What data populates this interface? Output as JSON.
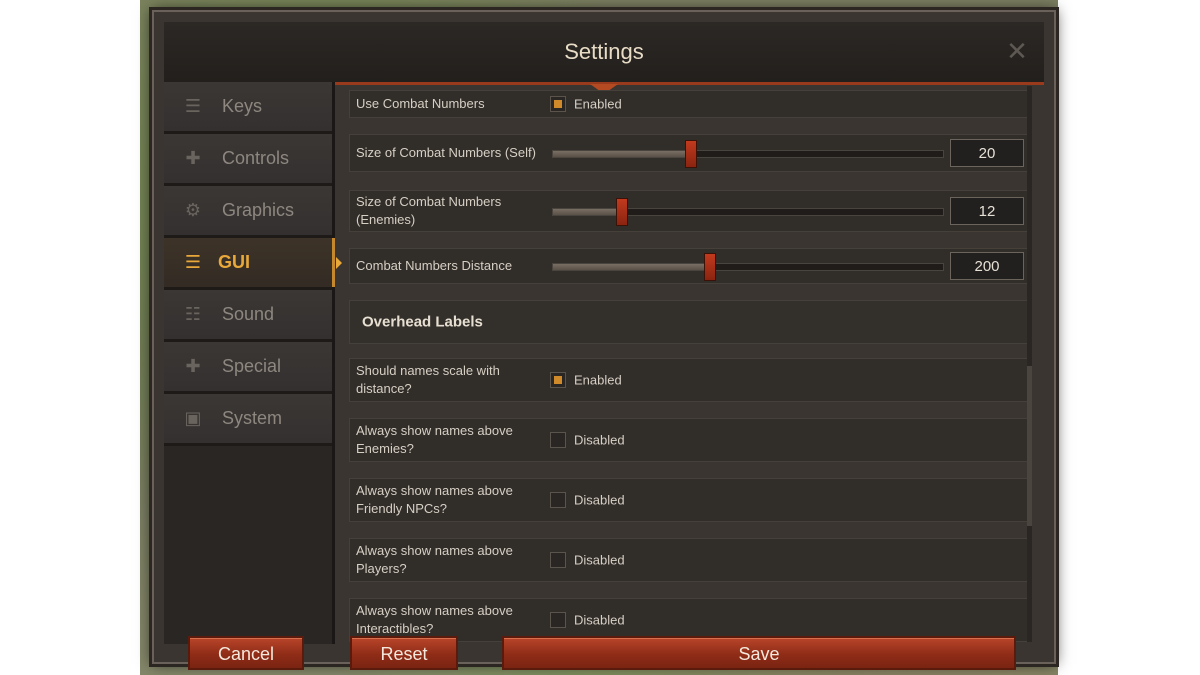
{
  "window": {
    "title": "Settings",
    "close_symbol": "✕"
  },
  "sidebar": {
    "items": [
      {
        "label": "Keys",
        "icon": "hamburger-icon",
        "glyph": "☰",
        "active": false
      },
      {
        "label": "Controls",
        "icon": "puzzle-icon",
        "glyph": "✚",
        "active": false
      },
      {
        "label": "Graphics",
        "icon": "gear-icon",
        "glyph": "⚙",
        "active": false
      },
      {
        "label": "GUI",
        "icon": "list-icon",
        "glyph": "☰",
        "active": true
      },
      {
        "label": "Sound",
        "icon": "sliders-icon",
        "glyph": "☷",
        "active": false
      },
      {
        "label": "Special",
        "icon": "puzzle-icon",
        "glyph": "✚",
        "active": false
      },
      {
        "label": "System",
        "icon": "floppy-icon",
        "glyph": "▣",
        "active": false
      }
    ]
  },
  "settings": {
    "use_combat_numbers": {
      "label": "Use Combat Numbers",
      "state": "Enabled",
      "checked": true
    },
    "size_self": {
      "label": "Size of Combat Numbers (Self)",
      "value": "20",
      "level": 0.35
    },
    "size_enemies": {
      "label": "Size of Combat Numbers (Enemies)",
      "value": "12",
      "level": 0.175
    },
    "distance": {
      "label": "Combat Numbers Distance",
      "value": "200",
      "level": 0.4
    },
    "overhead_section": "Overhead Labels",
    "names_scale": {
      "label": "Should names scale with distance?",
      "state": "Enabled",
      "checked": true
    },
    "show_enemies": {
      "label": "Always show names above Enemies?",
      "state": "Disabled",
      "checked": false
    },
    "show_friendly": {
      "label": "Always show names above Friendly NPCs?",
      "state": "Disabled",
      "checked": false
    },
    "show_players": {
      "label": "Always show names above Players?",
      "state": "Disabled",
      "checked": false
    },
    "show_interactibles": {
      "label": "Always show names above Interactibles?",
      "state": "Disabled",
      "checked": false
    }
  },
  "footer": {
    "cancel": "Cancel",
    "reset": "Reset",
    "save": "Save"
  },
  "colors": {
    "accent": "#e8a83a",
    "button": "#a33a20"
  }
}
